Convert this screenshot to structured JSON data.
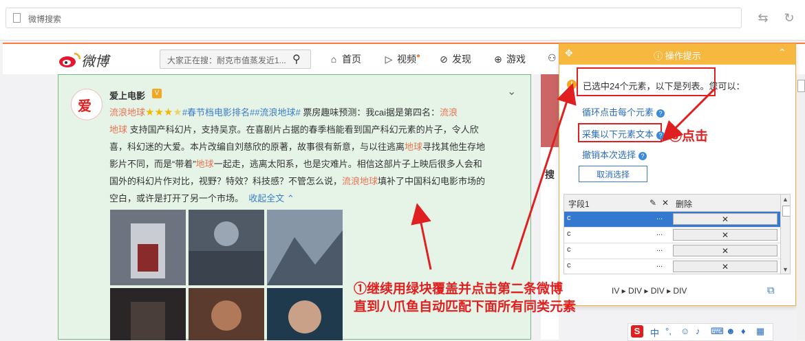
{
  "browser": {
    "address": "微博搜索",
    "back_icon": "arrows-icon",
    "refresh_icon": "refresh-icon"
  },
  "header": {
    "logo_text": "微博",
    "search_placeholder": "大家正在搜：耐克市值蒸发近1...",
    "nav": [
      {
        "label": "首页",
        "icon": "home-icon"
      },
      {
        "label": "视频",
        "icon": "video-icon"
      },
      {
        "label": "发现",
        "icon": "discover-icon"
      },
      {
        "label": "游戏",
        "icon": "game-icon"
      }
    ]
  },
  "post": {
    "avatar_text": "爱",
    "username": "爱上电影",
    "v_badge": "V",
    "line1_a": "流浪地球",
    "stars": "★★★",
    "half_star": "★",
    "line1_tag": "#春节档电影排名##流浪地球#",
    "line1_b": " 票房趣味预测：我cai据是第四名：",
    "line1_c": "流浪",
    "line2_a": "地球",
    "line2_b": " 支持国产科幻片，支持吴京。在喜剧片占据的春季档能看到国产科幻元素的片子，令人欣",
    "line3": "喜，科幻迷的大爱。本片改编自刘慈欣的原著，故事很有新意，与以往逃离",
    "line3_red": "地球",
    "line3_end": "寻找其他生存地",
    "line4_a": "影片不同，而是“带着”",
    "line4_red": "地球",
    "line4_b": "一起走，逃离太阳系，也是灾难片。相信这部片子上映后很多人会和",
    "line5_a": "国外的科幻片作对比，视野？特效？科技感？不管怎么说，",
    "line5_red": "流浪地球",
    "line5_b": "填补了中国科幻电影市场的",
    "line6": "空白，或许是打开了另一个市场。",
    "collapse": "收起全文"
  },
  "panel": {
    "title": "操作提示",
    "selected_text": "已选中24个元素，以下是列表。您可以：",
    "loop_link": "循环点击每个元素",
    "extract_link": "采集以下元素文本",
    "undo_link": "撤销本次选择",
    "cancel_button": "取消选择",
    "table": {
      "col_field": "字段1",
      "col_delete": "删除",
      "rows": [
        {
          "value": "c",
          "dots": "...",
          "del": "✕",
          "selected": true
        },
        {
          "value": "c",
          "dots": "...",
          "del": "✕",
          "selected": false
        },
        {
          "value": "c",
          "dots": "...",
          "del": "✕",
          "selected": false
        },
        {
          "value": "c",
          "dots": "...",
          "del": "✕",
          "selected": false
        }
      ]
    },
    "path": "IV ▸ DIV ▸ DIV ▸ DIV"
  },
  "annotations": {
    "step1_line1": "①继续用绿块覆盖并点击第二条微博",
    "step1_line2": "直到八爪鱼自动匹配下面所有同类元素",
    "step3": "③点击"
  },
  "colors": {
    "accent_orange": "#f7b840",
    "weibo_orange": "#fa7d3c",
    "highlight_red": "#e02020",
    "link_blue": "#2b6dbf",
    "selection_green": "#e6f4e8"
  }
}
